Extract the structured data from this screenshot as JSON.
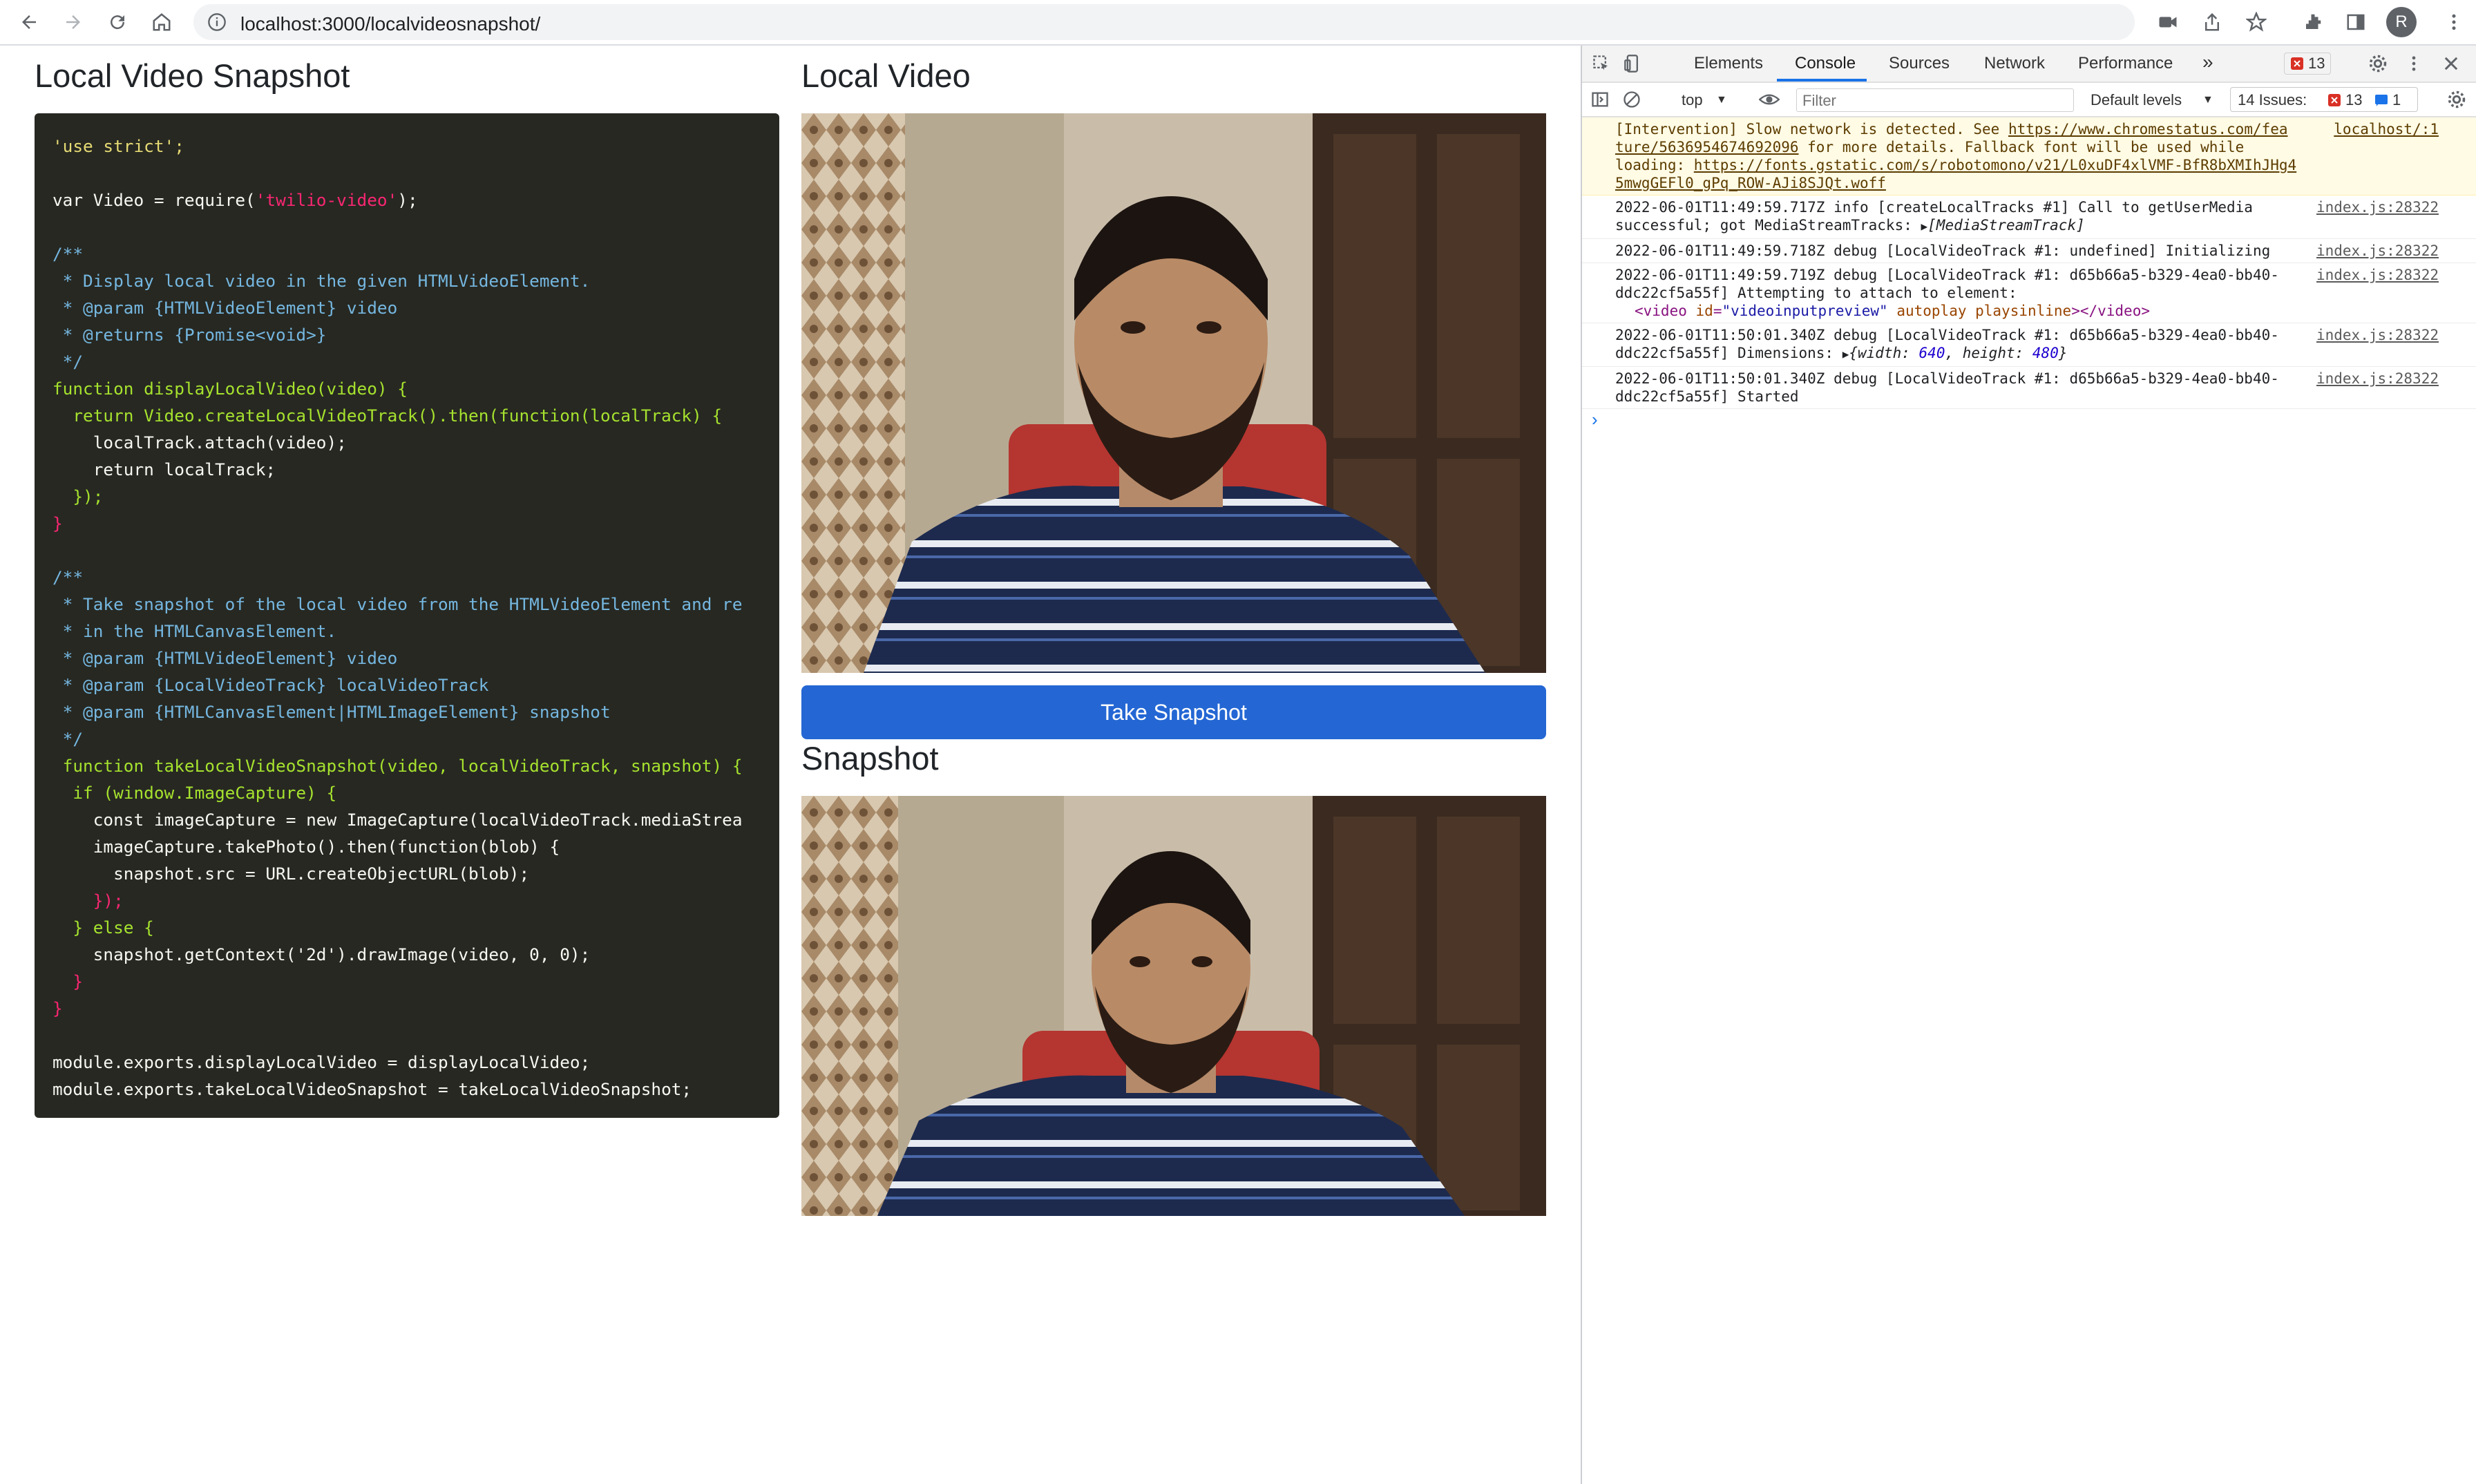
{
  "browser": {
    "url": "localhost:3000/localvideosnapshot/",
    "profile_initial": "R"
  },
  "page": {
    "title": "Local Video Snapshot",
    "video_heading": "Local Video",
    "snapshot_heading": "Snapshot",
    "snapshot_button": "Take Snapshot"
  },
  "code": {
    "l1": "'use strict';",
    "l3a": "var Video = require(",
    "l3b": "'twilio-video'",
    "l3c": ");",
    "l5": "/**",
    "l6": " * Display local video in the given HTMLVideoElement.",
    "l7": " * @param {HTMLVideoElement} video",
    "l8": " * @returns {Promise<void>}",
    "l9": " */",
    "l10": "function displayLocalVideo(video) {",
    "l11": "  return Video.createLocalVideoTrack().then(function(localTrack) {",
    "l12": "    localTrack.attach(video);",
    "l13": "    return localTrack;",
    "l14": "  });",
    "l15": "}",
    "l17": "/**",
    "l18": " * Take snapshot of the local video from the HTMLVideoElement and re",
    "l19": " * in the HTMLCanvasElement.",
    "l20": " * @param {HTMLVideoElement} video",
    "l21": " * @param {LocalVideoTrack} localVideoTrack",
    "l22": " * @param {HTMLCanvasElement|HTMLImageElement} snapshot",
    "l23": " */",
    "l24": " function takeLocalVideoSnapshot(video, localVideoTrack, snapshot) {",
    "l25": "  if (window.ImageCapture) {",
    "l26": "    const imageCapture = new ImageCapture(localVideoTrack.mediaStrea",
    "l27": "    imageCapture.takePhoto().then(function(blob) {",
    "l28": "      snapshot.src = URL.createObjectURL(blob);",
    "l29": "    });",
    "l30": "  } else {",
    "l31": "    snapshot.getContext('2d').drawImage(video, 0, 0);",
    "l32": "  }",
    "l33": "}",
    "l35": "module.exports.displayLocalVideo = displayLocalVideo;",
    "l36": "module.exports.takeLocalVideoSnapshot = takeLocalVideoSnapshot;"
  },
  "devtools": {
    "tabs": [
      "Elements",
      "Console",
      "Sources",
      "Network",
      "Performance"
    ],
    "more": "»",
    "error_count": "13",
    "context": "top",
    "filter_placeholder": "Filter",
    "levels": "Default levels",
    "issues_label": "14 Issues:",
    "issues_errors": "13",
    "issues_info": "1",
    "messages": [
      {
        "text_a": "[Intervention] Slow network is detected. See ",
        "link_a": "https://www.chromestatus.com/fea",
        "source": "localhost/:1",
        "link_b": "ture/5636954674692096",
        "text_b": " for more details. Fallback font will be used while loading: ",
        "link_c": "https://fonts.gstatic.com/s/robotomono/v21/L0xuDF4xlVMF-BfR8bXMIhJHg45mwgGEFl0_gPq_ROW-AJi8SJQt.woff"
      },
      {
        "text": "2022-06-01T11:49:59.717Z info [createLocalTracks #1] Call to getUserMedia successful; got MediaStreamTracks: ",
        "obj": "[MediaStreamTrack]",
        "source": "index.js:28322"
      },
      {
        "text": "2022-06-01T11:49:59.718Z debug [LocalVideoTrack #1: undefined] Initializing",
        "source": "index.js:28322"
      },
      {
        "text": "2022-06-01T11:49:59.719Z debug [LocalVideoTrack #1: d65b66a5-b329-4ea0-bb40-ddc22cf5a55f] Attempting to attach to element:",
        "el_open": "<video ",
        "el_attr1": "id",
        "el_val1": "\"videoinputpreview\"",
        "el_attr2": " autoplay playsinline",
        "el_close": "></video>",
        "source": "index.js:28322"
      },
      {
        "text": "2022-06-01T11:50:01.340Z debug [LocalVideoTrack #1: d65b66a5-b329-4ea0-bb40-ddc22cf5a55f] Dimensions: ",
        "obj_a": "{width: ",
        "w": "640",
        "obj_b": ", height: ",
        "h": "480",
        "obj_c": "}",
        "source": "index.js:28322"
      },
      {
        "text": "2022-06-01T11:50:01.340Z debug [LocalVideoTrack #1: d65b66a5-b329-4ea0-bb40-ddc22cf5a55f] Started",
        "source": "index.js:28322"
      }
    ],
    "prompt": "›"
  },
  "colors": {
    "accent_button": "#2467d4",
    "code_bg": "#272822",
    "warning_bg": "#fffbe5",
    "error_red": "#d93025"
  }
}
